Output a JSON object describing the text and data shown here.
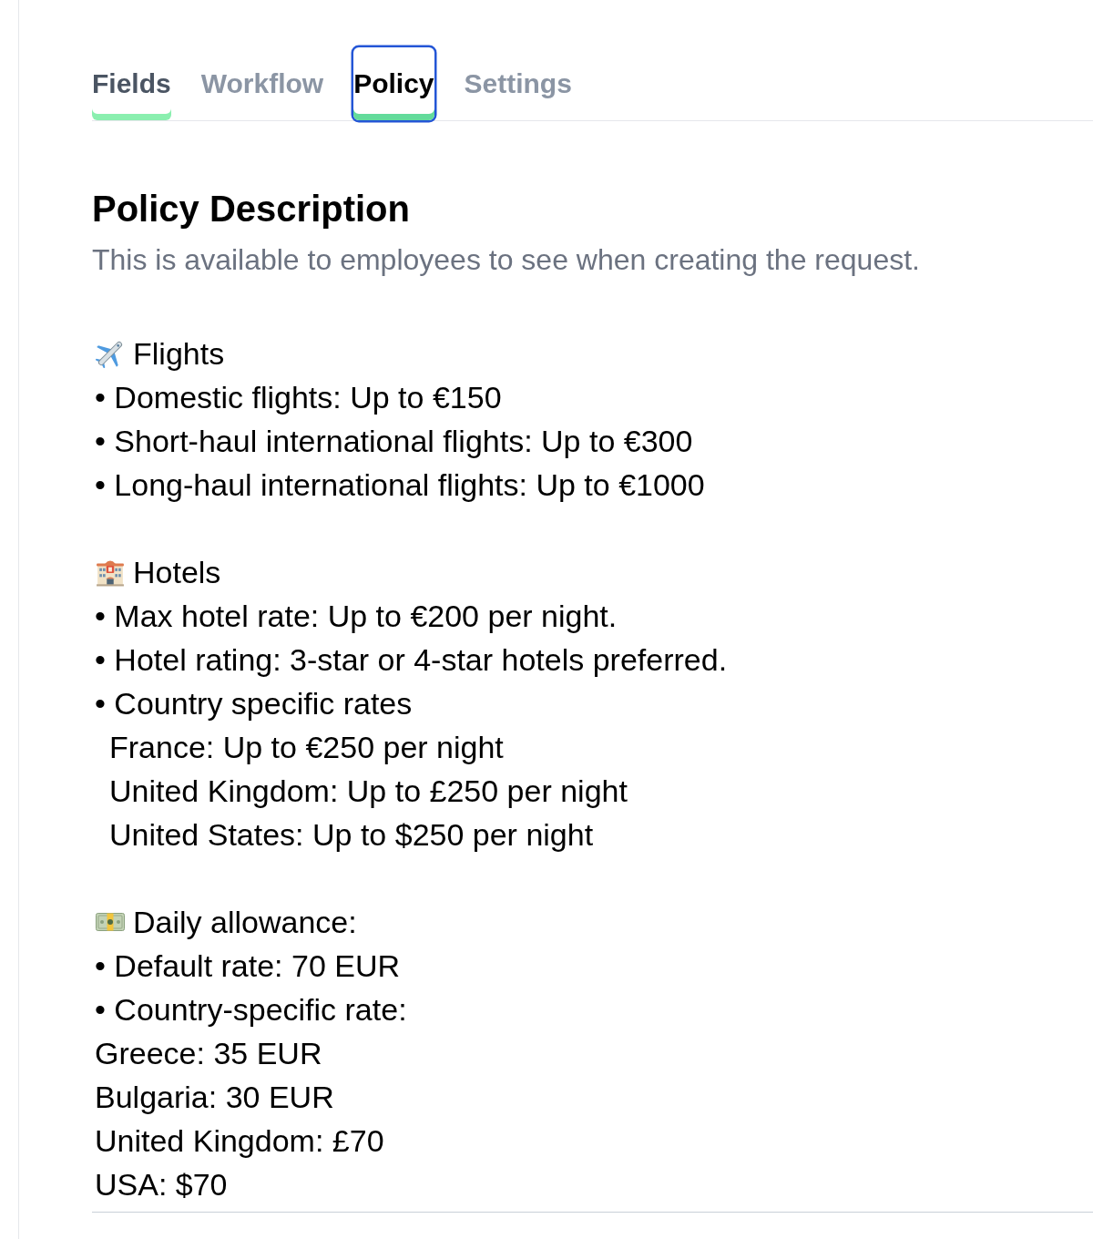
{
  "tabs": [
    {
      "label": "Fields",
      "selected": false,
      "hovered": true,
      "focused": false
    },
    {
      "label": "Workflow",
      "selected": false,
      "hovered": false,
      "focused": false
    },
    {
      "label": "Policy",
      "selected": true,
      "hovered": false,
      "focused": true
    },
    {
      "label": "Settings",
      "selected": false,
      "hovered": false,
      "focused": false
    }
  ],
  "policy": {
    "title": "Policy Description",
    "subtitle": "This is available to employees to see when creating the request.",
    "sections": [
      {
        "heading": "Flights",
        "lines": [
          {
            "text": "• Domestic flights: Up to €150"
          },
          {
            "text": "• Short-haul international flights: Up to €300"
          },
          {
            "text": "• Long-haul international flights: Up to €1000"
          }
        ]
      },
      {
        "heading": "Hotels",
        "lines": [
          {
            "text": "• Max hotel rate: Up to €200 per night."
          },
          {
            "text": "• Hotel rating: 3-star or 4-star hotels preferred."
          },
          {
            "text": "• Country specific rates",
            "children": [
              {
                "text": "France: Up to €250 per night"
              },
              {
                "text": "United Kingdom: Up to £250 per night"
              },
              {
                "text": "United States: Up to $250 per night"
              }
            ]
          }
        ]
      },
      {
        "heading": "Daily allowance:",
        "lines": [
          {
            "text": "• Default rate: 70 EUR"
          },
          {
            "text": "• Country-specific rate:"
          },
          {
            "text": "Greece: 35 EUR"
          },
          {
            "text": "Bulgaria: 30 EUR"
          },
          {
            "text": "United Kingdom: £70"
          },
          {
            "text": "USA: $70"
          }
        ]
      }
    ]
  }
}
